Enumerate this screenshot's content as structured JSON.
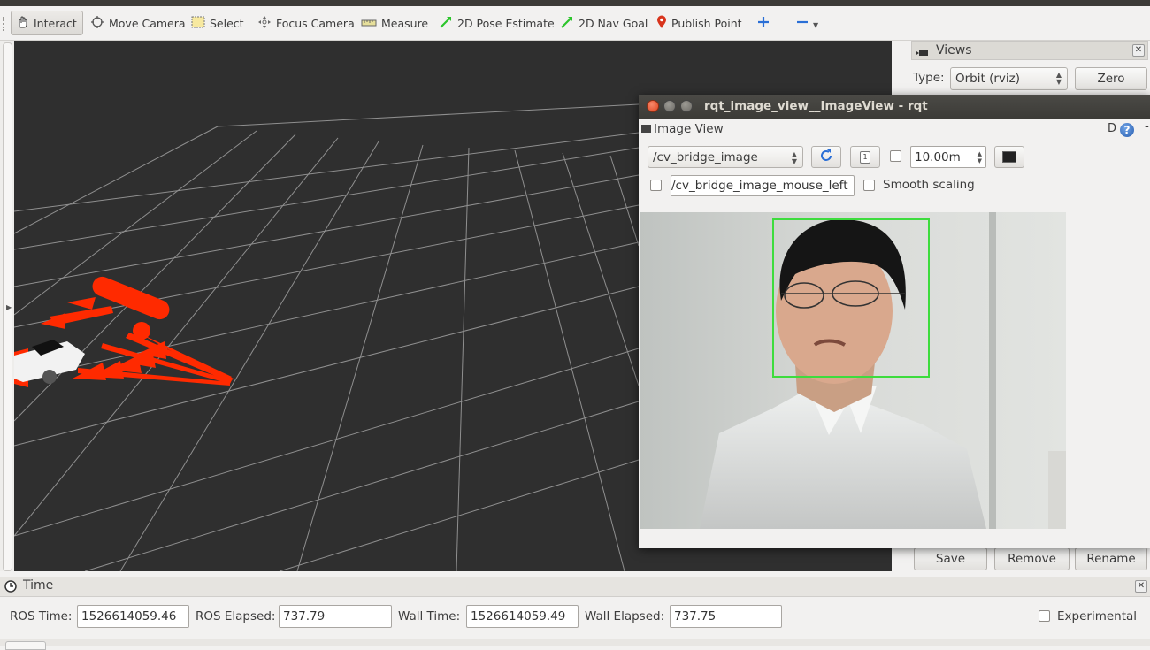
{
  "toolbar": {
    "interact": "Interact",
    "move_camera": "Move Camera",
    "select": "Select",
    "focus_camera": "Focus Camera",
    "measure": "Measure",
    "pose_estimate": "2D Pose Estimate",
    "nav_goal": "2D Nav Goal",
    "publish_point": "Publish Point"
  },
  "views_panel": {
    "title": "Views",
    "type_label": "Type:",
    "type_value": "Orbit (rviz)",
    "zero_button": "Zero",
    "save_button": "Save",
    "remove_button": "Remove",
    "rename_button": "Rename"
  },
  "rqt_window": {
    "title": "rqt_image_view__ImageView - rqt",
    "plugin_title": "Image View",
    "help_d": "D",
    "topic": "/cv_bridge_image",
    "zoom_value": "10.00m",
    "mouse_topic": "/cv_bridge_image_mouse_left",
    "smooth_scaling_label": "Smooth scaling"
  },
  "time_panel": {
    "title": "Time",
    "ros_time_label": "ROS Time:",
    "ros_time": "1526614059.46",
    "ros_elapsed_label": "ROS Elapsed:",
    "ros_elapsed": "737.79",
    "wall_time_label": "Wall Time:",
    "wall_time": "1526614059.49",
    "wall_elapsed_label": "Wall Elapsed:",
    "wall_elapsed": "737.75",
    "experimental_label": "Experimental"
  },
  "colors": {
    "viewport_bg": "#2f2f2f",
    "grid_line": "#a0a0a0",
    "arrow_red": "#ff2a00",
    "face_box": "#3ddc3d"
  }
}
